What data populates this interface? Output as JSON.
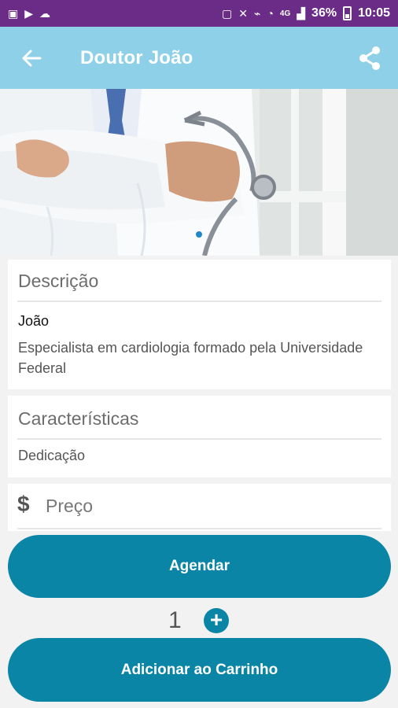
{
  "status_bar": {
    "battery": "36%",
    "time": "10:05",
    "network": "4G"
  },
  "header": {
    "title": "Doutor João",
    "back_icon": "arrow-left-icon",
    "share_icon": "share-icon"
  },
  "description": {
    "heading": "Descrição",
    "name": "João",
    "text": "Especialista em cardiologia formado pela Universidade Federal"
  },
  "features": {
    "heading": "Características",
    "text": "Dedicação"
  },
  "price": {
    "symbol": "$",
    "label": "Preço"
  },
  "actions": {
    "schedule_label": "Agendar",
    "quantity": "1",
    "add_to_cart_label": "Adicionar ao Carrinho"
  },
  "colors": {
    "status_bar": "#6a2c86",
    "app_bar": "#8dd0e8",
    "primary_button": "#0a85a6",
    "indicator": "#1e88c8"
  }
}
